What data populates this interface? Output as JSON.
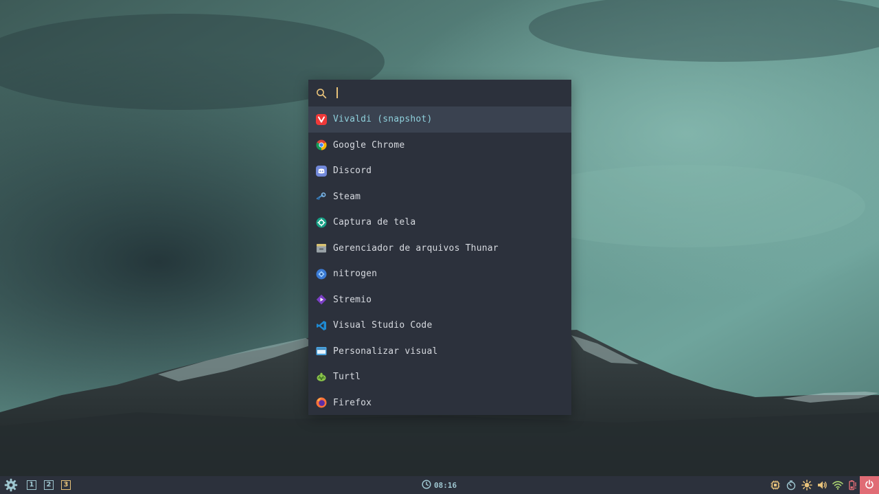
{
  "colors": {
    "panel_bg": "#2c313c",
    "selected_bg": "#3a4250",
    "selected_text": "#8fd0dc",
    "text": "#d7dae0",
    "accent_yellow": "#e8c27a",
    "accent_cyan": "#9fc7d1",
    "power_red": "#e06c75"
  },
  "launcher": {
    "search": {
      "icon": "search-icon",
      "value": "",
      "placeholder": ""
    },
    "items": [
      {
        "label": "Vivaldi (snapshot)",
        "icon": "vivaldi-icon",
        "selected": true
      },
      {
        "label": "Google Chrome",
        "icon": "chrome-icon",
        "selected": false
      },
      {
        "label": "Discord",
        "icon": "discord-icon",
        "selected": false
      },
      {
        "label": "Steam",
        "icon": "steam-icon",
        "selected": false
      },
      {
        "label": "Captura de tela",
        "icon": "screenshot-icon",
        "selected": false
      },
      {
        "label": "Gerenciador de arquivos Thunar",
        "icon": "file-manager-icon",
        "selected": false
      },
      {
        "label": "nitrogen",
        "icon": "nitrogen-icon",
        "selected": false
      },
      {
        "label": "Stremio",
        "icon": "stremio-icon",
        "selected": false
      },
      {
        "label": "Visual Studio Code",
        "icon": "vscode-icon",
        "selected": false
      },
      {
        "label": "Personalizar visual",
        "icon": "appearance-icon",
        "selected": false
      },
      {
        "label": "Turtl",
        "icon": "turtl-icon",
        "selected": false
      },
      {
        "label": "Firefox",
        "icon": "firefox-icon",
        "selected": false
      }
    ]
  },
  "taskbar": {
    "start_icon": "gear-icon",
    "workspaces": [
      {
        "label": "1",
        "active": false
      },
      {
        "label": "2",
        "active": false
      },
      {
        "label": "3",
        "active": true
      }
    ],
    "clock": {
      "icon": "clock-icon",
      "time": "08:16"
    },
    "tray": [
      "cpu-icon",
      "timer-icon",
      "brightness-icon",
      "volume-icon",
      "wifi-icon",
      "battery-icon"
    ],
    "power_icon": "power-icon"
  }
}
